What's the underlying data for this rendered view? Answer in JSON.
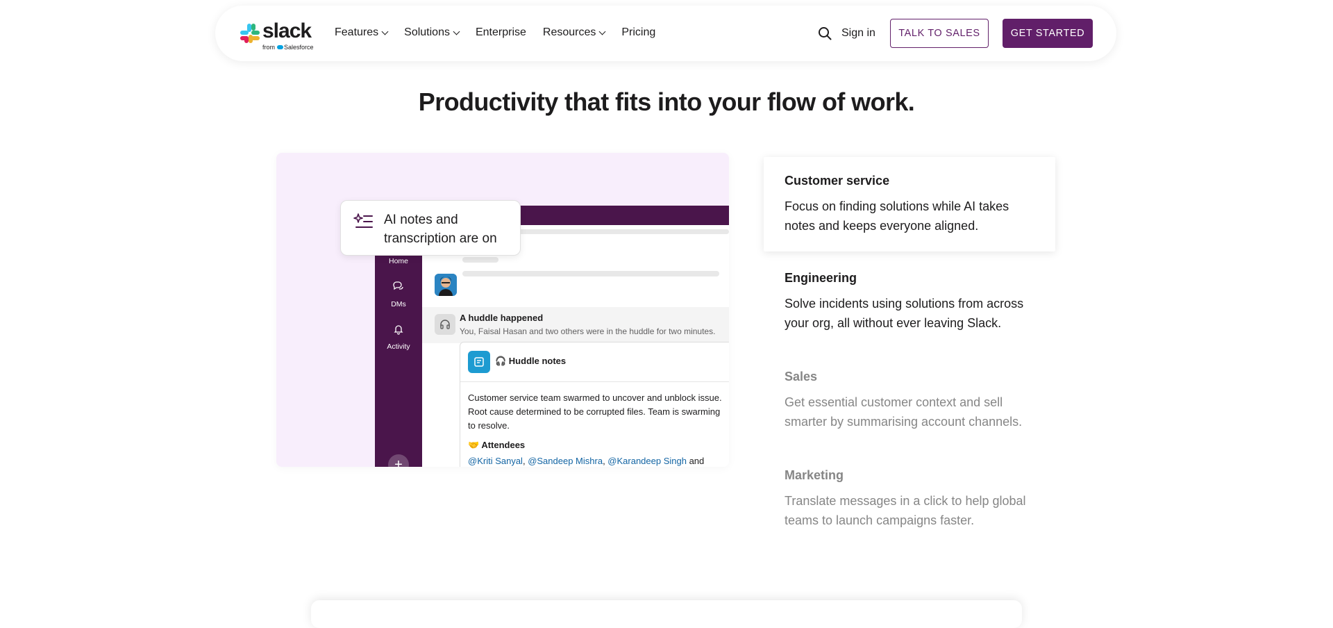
{
  "brand": {
    "wordmark": "slack",
    "sub_from": "from",
    "sub_company": "Salesforce",
    "colors": {
      "aubergine": "#611f69",
      "dark_aubergine": "#4a154b",
      "link_blue": "#1264a3"
    }
  },
  "nav": {
    "items": [
      {
        "label": "Features",
        "has_dropdown": true
      },
      {
        "label": "Solutions",
        "has_dropdown": true
      },
      {
        "label": "Enterprise",
        "has_dropdown": false
      },
      {
        "label": "Resources",
        "has_dropdown": true
      },
      {
        "label": "Pricing",
        "has_dropdown": false
      }
    ],
    "search_icon": "search-icon",
    "sign_in": "Sign in",
    "talk_to_sales": "TALK TO SALES",
    "get_started": "GET STARTED"
  },
  "headline": "Productivity that fits into your flow of work.",
  "illustration": {
    "ai_pill": "AI notes and transcription are on",
    "sidebar": [
      {
        "label": "Home",
        "icon": "home-icon",
        "active": true
      },
      {
        "label": "DMs",
        "icon": "dms-icon",
        "active": false
      },
      {
        "label": "Activity",
        "icon": "bell-icon",
        "active": false
      }
    ],
    "huddle": {
      "title": "A huddle happened",
      "subtitle": "You, Faisal Hasan and two others were in the huddle for two minutes."
    },
    "notes": {
      "title": "🎧 Huddle notes",
      "body": "Customer service team swarmed to uncover and unblock issue. Root cause determined to be corrupted files. Team is swarming to resolve.",
      "attendees_title": "🤝 Attendees",
      "attendees": [
        "@Kriti Sanyal",
        "@Sandeep Mishra",
        "@Karandeep Singh"
      ],
      "attendees_sep": ", ",
      "attendees_tail": " and"
    }
  },
  "tabs": [
    {
      "title": "Customer service",
      "desc": "Focus on finding solutions while AI takes notes and keeps everyone aligned.",
      "active": true
    },
    {
      "title": "Engineering",
      "desc": "Solve incidents using solutions from across your org, all without ever leaving Slack.",
      "active": false
    },
    {
      "title": "Sales",
      "desc": "Get essential customer context and sell smarter by summarising account channels.",
      "active": false
    },
    {
      "title": "Marketing",
      "desc": "Translate messages in a click to help global teams to launch campaigns faster.",
      "active": false
    }
  ]
}
